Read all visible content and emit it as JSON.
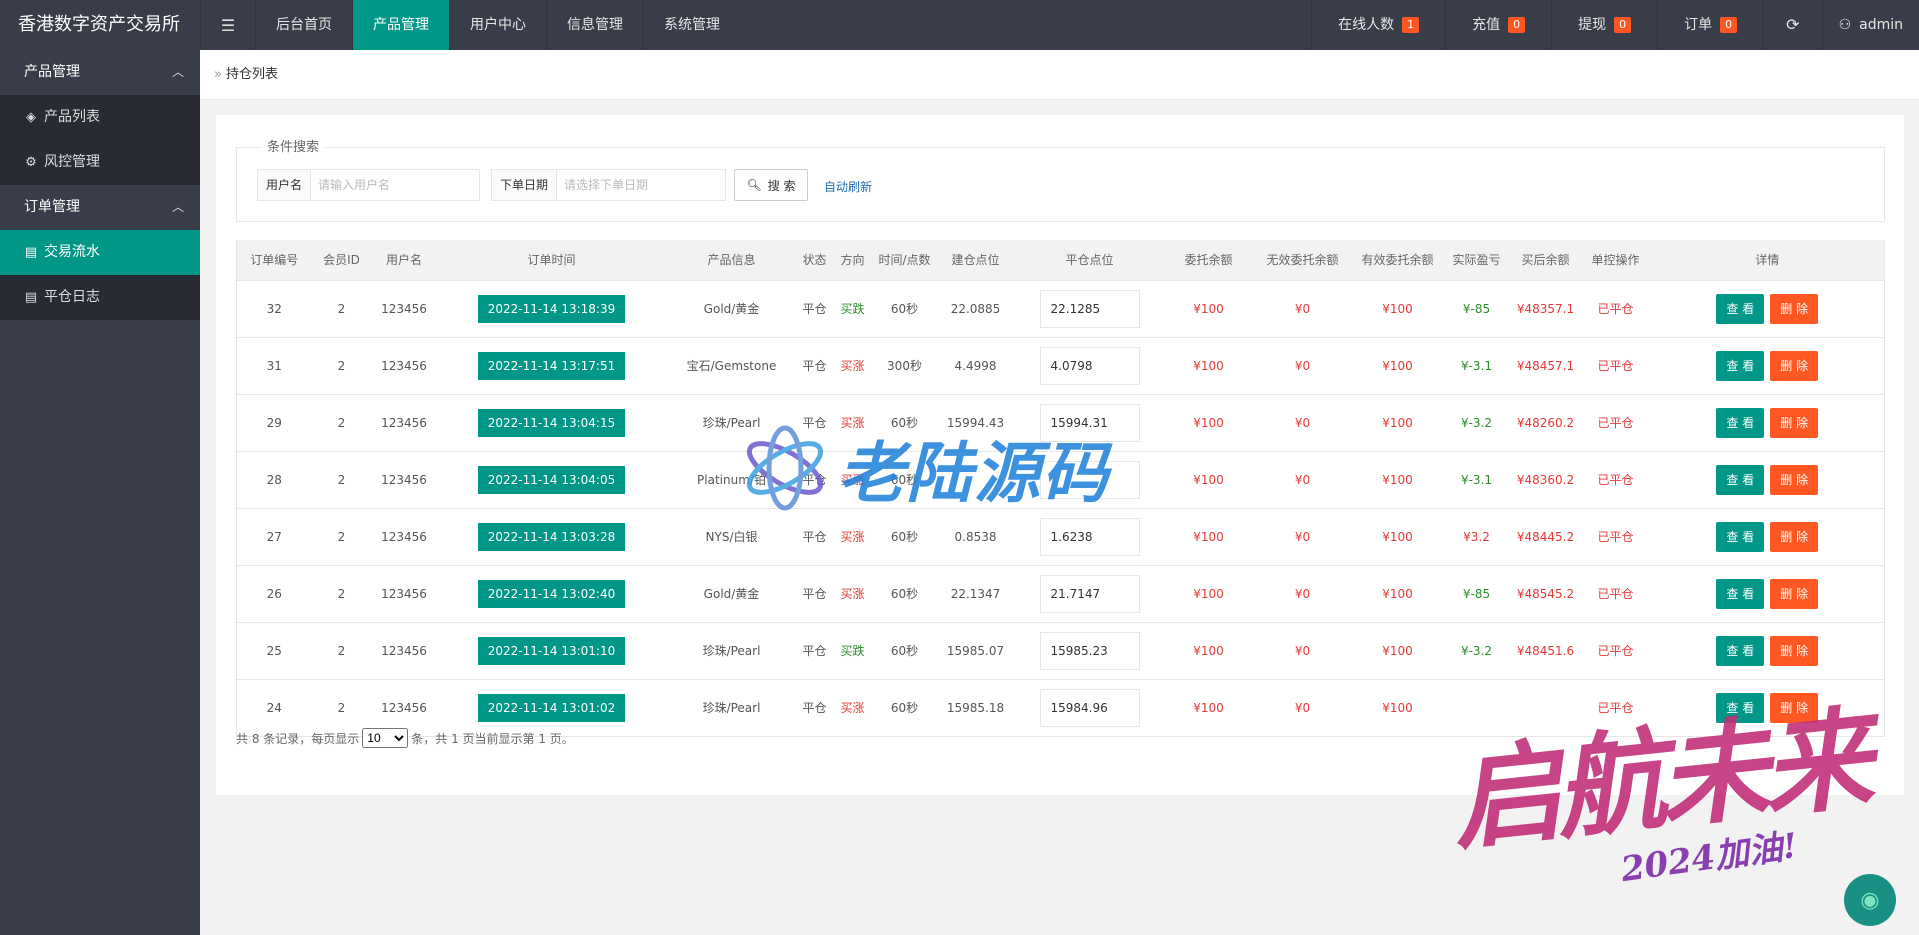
{
  "app_title": "香港数字资产交易所",
  "menu_toggle_icon": "menu-icon",
  "nav": [
    "后台首页",
    "产品管理",
    "用户中心",
    "信息管理",
    "系统管理"
  ],
  "top_right": {
    "online": {
      "label": "在线人数",
      "count": "1"
    },
    "recharge": {
      "label": "充值",
      "count": "0"
    },
    "withdraw": {
      "label": "提现",
      "count": "0"
    },
    "order": {
      "label": "订单",
      "count": "0"
    },
    "user": "admin"
  },
  "sidebar": {
    "group1": "产品管理",
    "item1": "产品列表",
    "item2": "风控管理",
    "group2": "订单管理",
    "item3": "交易流水",
    "item4": "平仓日志"
  },
  "breadcrumb": "持仓列表",
  "search": {
    "legend": "条件搜索",
    "user_label": "用户名",
    "user_placeholder": "请输入用户名",
    "date_label": "下单日期",
    "date_placeholder": "请选择下单日期",
    "button": "搜 索",
    "auto_refresh": "自动刷新"
  },
  "table": {
    "headers": [
      "订单编号",
      "会员ID",
      "用户名",
      "订单时间",
      "产品信息",
      "状态",
      "方向",
      "时间/点数",
      "建仓点位",
      "平仓点位",
      "委托余额",
      "无效委托余额",
      "有效委托余额",
      "实际盈亏",
      "买后余额",
      "单控操作",
      "详情"
    ],
    "rows": [
      {
        "id": "32",
        "uid": "2",
        "user": "123456",
        "time": "2022-11-14 13:18:39",
        "product": "Gold/黄金",
        "status": "平仓",
        "dir": "买跌",
        "dir_type": "down",
        "period": "60秒",
        "open": "22.0885",
        "close": "22.1285",
        "entrust": "¥100",
        "invalid": "¥0",
        "valid": "¥100",
        "pnl": "¥-85",
        "balance": "¥48357.1",
        "op": "已平仓"
      },
      {
        "id": "31",
        "uid": "2",
        "user": "123456",
        "time": "2022-11-14 13:17:51",
        "product": "宝石/Gemstone",
        "status": "平仓",
        "dir": "买涨",
        "dir_type": "up",
        "period": "300秒",
        "open": "4.4998",
        "close": "4.0798",
        "entrust": "¥100",
        "invalid": "¥0",
        "valid": "¥100",
        "pnl": "¥-3.1",
        "balance": "¥48457.1",
        "op": "已平仓"
      },
      {
        "id": "29",
        "uid": "2",
        "user": "123456",
        "time": "2022-11-14 13:04:15",
        "product": "珍珠/Pearl",
        "status": "平仓",
        "dir": "买涨",
        "dir_type": "up",
        "period": "60秒",
        "open": "15994.43",
        "close": "15994.31",
        "entrust": "¥100",
        "invalid": "¥0",
        "valid": "¥100",
        "pnl": "¥-3.2",
        "balance": "¥48260.2",
        "op": "已平仓"
      },
      {
        "id": "28",
        "uid": "2",
        "user": "123456",
        "time": "2022-11-14 13:04:05",
        "product": "Platinum/铂",
        "status": "平仓",
        "dir": "买涨",
        "dir_type": "up",
        "period": "60秒",
        "open": "",
        "close": "",
        "entrust": "¥100",
        "invalid": "¥0",
        "valid": "¥100",
        "pnl": "¥-3.1",
        "balance": "¥48360.2",
        "op": "已平仓"
      },
      {
        "id": "27",
        "uid": "2",
        "user": "123456",
        "time": "2022-11-14 13:03:28",
        "product": "NYS/白银",
        "status": "平仓",
        "dir": "买涨",
        "dir_type": "up",
        "period": "60秒",
        "open": "0.8538",
        "close": "1.6238",
        "entrust": "¥100",
        "invalid": "¥0",
        "valid": "¥100",
        "pnl": "¥3.2",
        "balance": "¥48445.2",
        "op": "已平仓"
      },
      {
        "id": "26",
        "uid": "2",
        "user": "123456",
        "time": "2022-11-14 13:02:40",
        "product": "Gold/黄金",
        "status": "平仓",
        "dir": "买涨",
        "dir_type": "up",
        "period": "60秒",
        "open": "22.1347",
        "close": "21.7147",
        "entrust": "¥100",
        "invalid": "¥0",
        "valid": "¥100",
        "pnl": "¥-85",
        "balance": "¥48545.2",
        "op": "已平仓"
      },
      {
        "id": "25",
        "uid": "2",
        "user": "123456",
        "time": "2022-11-14 13:01:10",
        "product": "珍珠/Pearl",
        "status": "平仓",
        "dir": "买跌",
        "dir_type": "down",
        "period": "60秒",
        "open": "15985.07",
        "close": "15985.23",
        "entrust": "¥100",
        "invalid": "¥0",
        "valid": "¥100",
        "pnl": "¥-3.2",
        "balance": "¥48451.6",
        "op": "已平仓"
      },
      {
        "id": "24",
        "uid": "2",
        "user": "123456",
        "time": "2022-11-14 13:01:02",
        "product": "珍珠/Pearl",
        "status": "平仓",
        "dir": "买涨",
        "dir_type": "up",
        "period": "60秒",
        "open": "15985.18",
        "close": "15984.96",
        "entrust": "¥100",
        "invalid": "¥0",
        "valid": "¥100",
        "pnl": "",
        "balance": "",
        "op": "已平仓"
      }
    ],
    "view_label": "查 看",
    "delete_label": "删 除"
  },
  "pager": {
    "prefix": "共 8 条记录，每页显示",
    "page_size": "10",
    "suffix": "条，共 1 页当前显示第 1 页。"
  },
  "watermark": {
    "center": "老陆源码",
    "corner_big": "启航未来",
    "corner_small": "2024加油!"
  },
  "colors": {
    "accent": "#009688",
    "danger": "#ff5722",
    "topbar": "#393d49"
  }
}
